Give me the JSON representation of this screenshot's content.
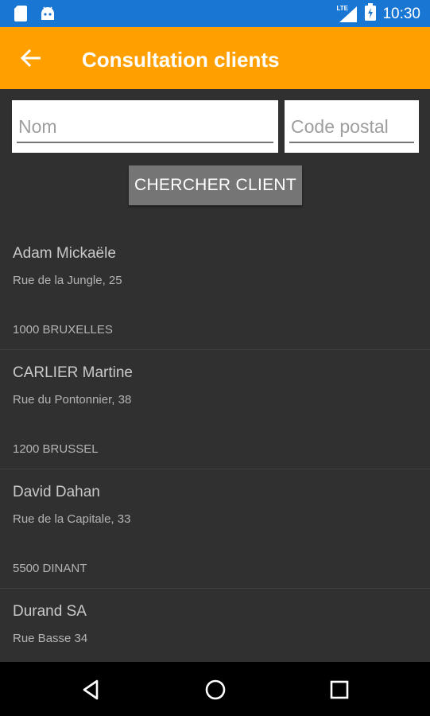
{
  "status_bar": {
    "time": "10:30",
    "network_label": "LTE",
    "icons": [
      "sd-card-icon",
      "android-icon",
      "signal-icon",
      "battery-icon"
    ]
  },
  "app_bar": {
    "title": "Consultation clients",
    "back_icon": "arrow-left-icon",
    "color": "#ffa000"
  },
  "search": {
    "name_placeholder": "Nom",
    "name_value": "",
    "postal_placeholder": "Code postal",
    "postal_value": "",
    "button_label": "CHERCHER CLIENT"
  },
  "clients": [
    {
      "name": "Adam Mickaële",
      "street": "Rue de la Jungle, 25",
      "city": "1000 BRUXELLES"
    },
    {
      "name": "CARLIER Martine",
      "street": "Rue du Pontonnier, 38",
      "city": "1200 BRUSSEL"
    },
    {
      "name": "David Dahan",
      "street": "Rue de la Capitale, 33",
      "city": "5500 DINANT"
    },
    {
      "name": "Durand SA",
      "street": "Rue Basse 34",
      "city": ""
    }
  ],
  "nav_bar": {
    "icons": [
      "nav-back-icon",
      "nav-home-icon",
      "nav-recent-icon"
    ]
  },
  "colors": {
    "status_bar": "#1976d2",
    "background": "#303030",
    "button": "#757575"
  }
}
